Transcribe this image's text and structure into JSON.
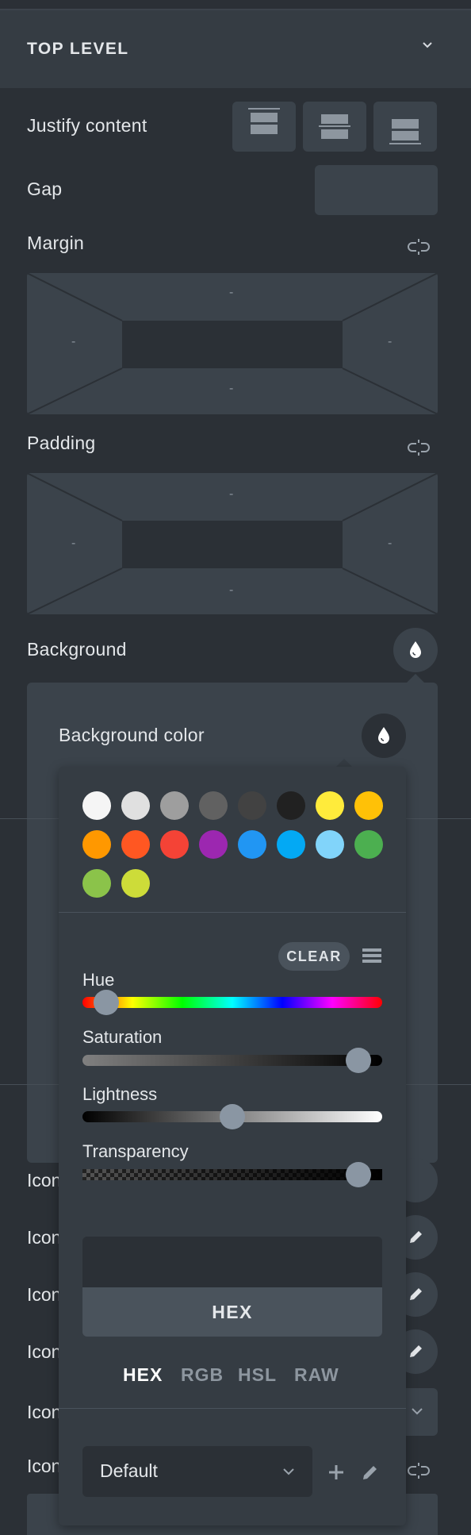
{
  "section": {
    "title": "TOP LEVEL"
  },
  "labels": {
    "justify_content": "Justify content",
    "gap": "Gap",
    "margin": "Margin",
    "padding": "Padding",
    "background": "Background"
  },
  "margin_box": {
    "top": "-",
    "left": "-",
    "right": "-",
    "bottom": "-"
  },
  "padding_box": {
    "top": "-",
    "left": "-",
    "right": "-",
    "bottom": "-"
  },
  "background_panel": {
    "title": "Background color"
  },
  "color_picker": {
    "swatches": [
      "#f5f5f5",
      "#e0e0e0",
      "#9e9e9e",
      "#616161",
      "#424242",
      "#212121",
      "#ffeb3b",
      "#ffc107",
      "#ff9800",
      "#ff5722",
      "#f44336",
      "#9c27b0",
      "#2196f3",
      "#03a9f4",
      "#81d4fa",
      "#4caf50",
      "#8bc34a",
      "#cddc39"
    ],
    "clear_label": "CLEAR",
    "hue_label": "Hue",
    "saturation_label": "Saturation",
    "lightness_label": "Lightness",
    "transparency_label": "Transparency",
    "hue_value": 0.04,
    "saturation_value": 0.96,
    "lightness_value": 0.5,
    "transparency_value": 0.96,
    "hex_value": "",
    "format_button": "HEX",
    "modes": [
      "HEX",
      "RGB",
      "HSL",
      "RAW"
    ],
    "active_mode": "HEX",
    "preset_select": "Default"
  },
  "background_rows": {
    "cut_label": "Icon"
  }
}
